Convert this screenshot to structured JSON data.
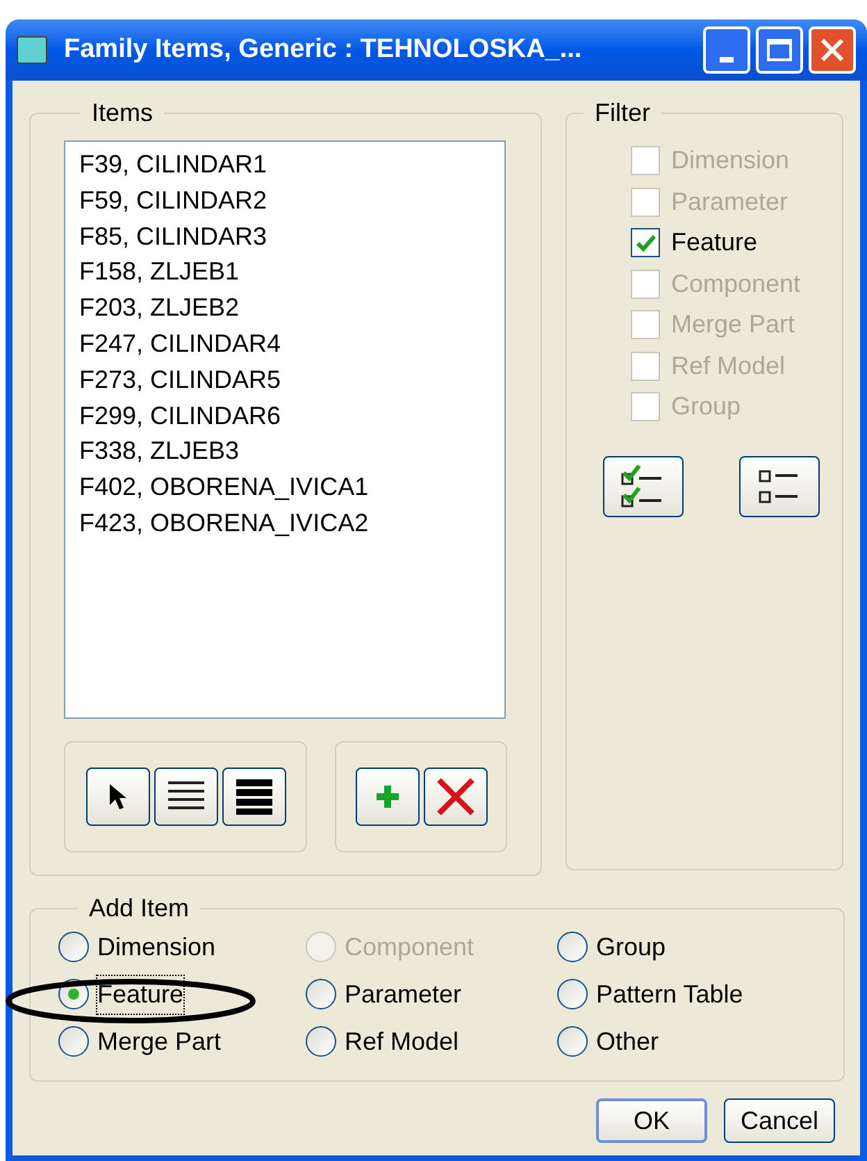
{
  "window": {
    "title": "Family Items,  Generic : TEHNOLOSKA_..."
  },
  "items": {
    "label": "Items",
    "list": [
      "F39, CILINDAR1",
      "F59, CILINDAR2",
      "F85, CILINDAR3",
      "F158, ZLJEB1",
      "F203, ZLJEB2",
      "F247, CILINDAR4",
      "F273, CILINDAR5",
      "F299, CILINDAR6",
      "F338, ZLJEB3",
      "F402, OBORENA_IVICA1",
      "F423, OBORENA_IVICA2"
    ]
  },
  "filter": {
    "label": "Filter",
    "options": [
      {
        "label": "Dimension",
        "checked": false,
        "disabled": true
      },
      {
        "label": "Parameter",
        "checked": false,
        "disabled": true
      },
      {
        "label": "Feature",
        "checked": true,
        "disabled": false
      },
      {
        "label": "Component",
        "checked": false,
        "disabled": true
      },
      {
        "label": "Merge Part",
        "checked": false,
        "disabled": true
      },
      {
        "label": "Ref Model",
        "checked": false,
        "disabled": true
      },
      {
        "label": "Group",
        "checked": false,
        "disabled": true
      }
    ]
  },
  "add_item": {
    "label": "Add Item",
    "options": [
      {
        "label": "Dimension",
        "selected": false,
        "disabled": false
      },
      {
        "label": "Component",
        "selected": false,
        "disabled": true
      },
      {
        "label": "Group",
        "selected": false,
        "disabled": false
      },
      {
        "label": "Feature",
        "selected": true,
        "disabled": false
      },
      {
        "label": "Parameter",
        "selected": false,
        "disabled": false
      },
      {
        "label": "Pattern Table",
        "selected": false,
        "disabled": false
      },
      {
        "label": "Merge Part",
        "selected": false,
        "disabled": false
      },
      {
        "label": "Ref Model",
        "selected": false,
        "disabled": false
      },
      {
        "label": "Other",
        "selected": false,
        "disabled": false
      }
    ]
  },
  "buttons": [
    "OK",
    "Cancel"
  ]
}
